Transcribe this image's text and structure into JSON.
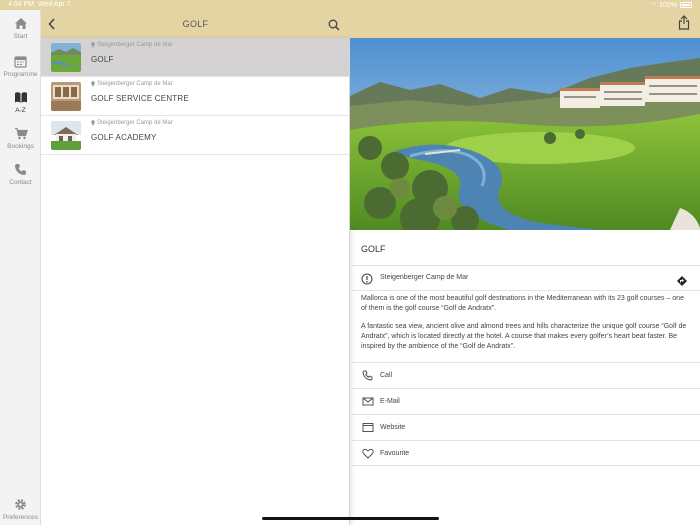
{
  "status_bar": {
    "time": "4:04 PM",
    "date": "Wed Apr 7",
    "battery": "100%"
  },
  "sidebar": {
    "items": [
      {
        "label": "Start",
        "icon": "home-icon"
      },
      {
        "label": "Programme",
        "icon": "calendar-icon"
      },
      {
        "label": "A-Z",
        "icon": "book-icon",
        "active": true
      },
      {
        "label": "Bookings",
        "icon": "cart-icon"
      },
      {
        "label": "Contact",
        "icon": "phone-icon"
      }
    ],
    "preferences": {
      "label": "Preferences",
      "icon": "gear-icon"
    }
  },
  "list_header": {
    "title": "GOLF"
  },
  "list": [
    {
      "location": "Steigenberger Camp de Mar",
      "title": "GOLF",
      "selected": true
    },
    {
      "location": "Steigenberger Camp de Mar",
      "title": "GOLF SERVICE CENTRE"
    },
    {
      "location": "Steigenberger Camp de Mar",
      "title": "GOLF ACADEMY"
    }
  ],
  "detail": {
    "title": "GOLF",
    "address": "Steigenberger Camp de Mar",
    "paragraphs": [
      "Mallorca is one of the most beautiful golf destinations in the Mediterranean with its 23 golf courses – one of them is the golf course “Golf de Andratx”.",
      "A fantastic sea view, ancient olive and almond trees and hills characterize the unique golf course “Golf de Andratx”, which is located directly at the hotel. A course that makes every golfer’s heart beat faster. Be inspired by the ambience of the “Golf de Andratx”."
    ],
    "actions": [
      {
        "label": "Call",
        "icon": "phone-icon"
      },
      {
        "label": "E-Mail",
        "icon": "mail-icon"
      },
      {
        "label": "Website",
        "icon": "browser-icon"
      },
      {
        "label": "Favourite",
        "icon": "heart-icon"
      }
    ]
  },
  "colors": {
    "header": "#e4d4a4",
    "selected_row": "#d4d2d3",
    "sidebar_bg": "#f3f3f3"
  }
}
